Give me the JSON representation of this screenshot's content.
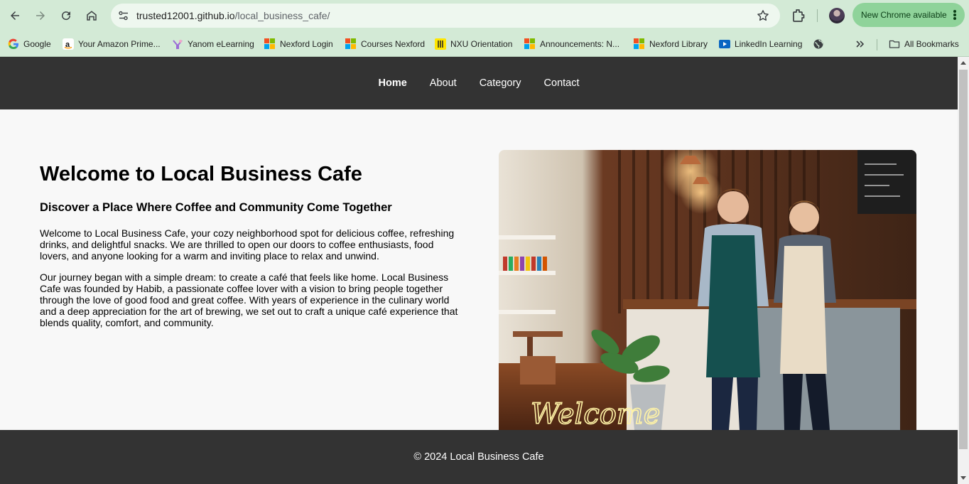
{
  "browser": {
    "url_host": "trusted12001.github.io",
    "url_path": "/local_business_cafe/",
    "update_label": "New Chrome available",
    "all_bookmarks_label": "All Bookmarks",
    "bookmarks": [
      {
        "label": "Google",
        "icon": "google-icon"
      },
      {
        "label": "Your Amazon Prime...",
        "icon": "amazon-icon"
      },
      {
        "label": "Yanom eLearning",
        "icon": "yanom-icon"
      },
      {
        "label": "Nexford Login",
        "icon": "microsoft-icon"
      },
      {
        "label": "Courses Nexford",
        "icon": "microsoft-icon"
      },
      {
        "label": "NXU Orientation",
        "icon": "nxu-icon"
      },
      {
        "label": "Announcements: N...",
        "icon": "microsoft-icon"
      },
      {
        "label": "Nexford Library",
        "icon": "microsoft-icon"
      },
      {
        "label": "LinkedIn Learning",
        "icon": "linkedin-learning-icon"
      }
    ]
  },
  "site": {
    "nav": [
      {
        "label": "Home",
        "active": true
      },
      {
        "label": "About",
        "active": false
      },
      {
        "label": "Category",
        "active": false
      },
      {
        "label": "Contact",
        "active": false
      }
    ],
    "hero": {
      "title": "Welcome to Local Business Cafe",
      "subtitle": "Discover a Place Where Coffee and Community Come Together",
      "paragraph_1": "Welcome to Local Business Cafe, your cozy neighborhood spot for delicious coffee, refreshing drinks, and delightful snacks. We are thrilled to open our doors to coffee enthusiasts, food lovers, and anyone looking for a warm and inviting place to relax and unwind.",
      "paragraph_2": "Our journey began with a simple dream: to create a café that feels like home. Local Business Cafe was founded by Habib, a passionate coffee lover with a vision to bring people together through the love of good food and great coffee. With years of experience in the culinary world and a deep appreciation for the art of brewing, we set out to craft a unique café experience that blends quality, comfort, and community.",
      "image_sign_text": "Welcome"
    },
    "footer": "© 2024 Local Business Cafe"
  },
  "colors": {
    "chrome_bg": "#d3ead6",
    "nav_bg": "#333333",
    "page_bg": "#f8f8f8",
    "update_pill": "#8fd39a"
  }
}
